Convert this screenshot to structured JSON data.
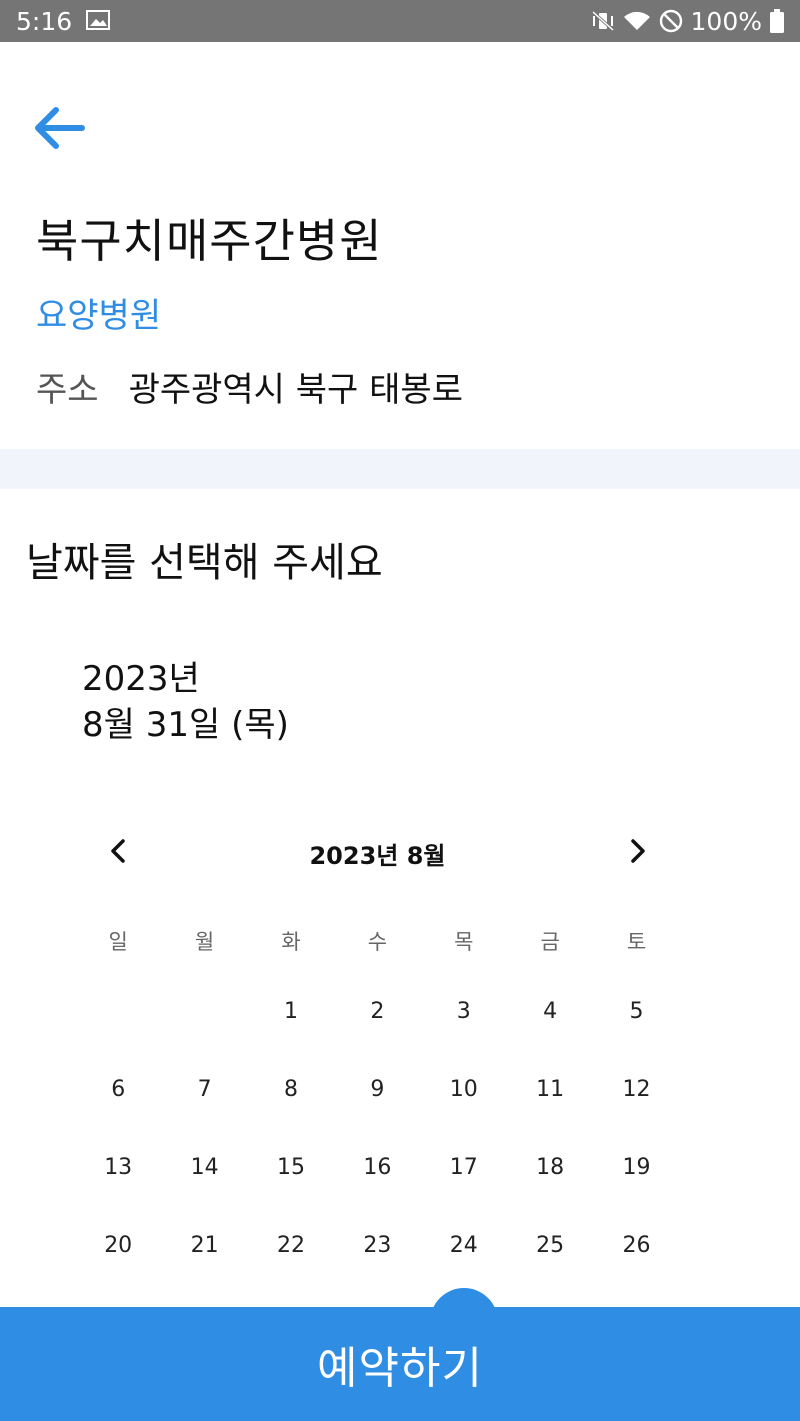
{
  "status_bar": {
    "time": "5:16",
    "battery": "100%",
    "icons": [
      "image-icon",
      "mute-vibrate-icon",
      "wifi-icon",
      "do-not-disturb-icon",
      "battery-icon"
    ]
  },
  "header": {
    "back_icon": "arrow-left-icon",
    "hospital_name": "북구치매주간병원",
    "hospital_type": "요양병원",
    "address_label": "주소",
    "address_value": "광주광역시 북구 태봉로"
  },
  "date_section": {
    "prompt": "날짜를 선택해 주세요",
    "selected_year": "2023년",
    "selected_date": "8월 31일 (목)"
  },
  "calendar": {
    "month_title": "2023년 8월",
    "weekdays": [
      "일",
      "월",
      "화",
      "수",
      "목",
      "금",
      "토"
    ],
    "leading_blank_days": 2,
    "days": [
      "1",
      "2",
      "3",
      "4",
      "5",
      "6",
      "7",
      "8",
      "9",
      "10",
      "11",
      "12",
      "13",
      "14",
      "15",
      "16",
      "17",
      "18",
      "19",
      "20",
      "21",
      "22",
      "23",
      "24",
      "25",
      "26"
    ]
  },
  "footer": {
    "reserve_label": "예약하기"
  },
  "colors": {
    "accent": "#2f8de4",
    "status_bar": "#757575",
    "divider": "#f1f4fa"
  }
}
